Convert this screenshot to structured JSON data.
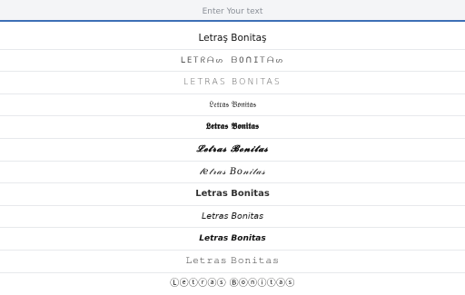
{
  "search": {
    "placeholder": "Enter Your text",
    "value": ""
  },
  "fonts": [
    {
      "text": "Letraş Bonitaş"
    },
    {
      "text": "ᒪEᎢᖇᗩᔕ ᗷOᑎIᎢᗩᔕ"
    },
    {
      "text": "LETRAS BONITAS"
    },
    {
      "text": "𝔏𝔢𝔱𝔯𝔞𝔰 𝔅𝔬𝔫𝔦𝔱𝔞𝔰"
    },
    {
      "text": "𝕷𝖊𝖙𝖗𝖆𝖘 𝕭𝖔𝖓𝖎𝖙𝖆𝖘"
    },
    {
      "text": "𝓛𝓮𝓽𝓻𝓪𝓼 𝓑𝓸𝓷𝓲𝓽𝓪𝓼"
    },
    {
      "text": "𝓁𝑒𝓉𝓇𝒶𝓈 𝐵𝑜𝓃𝒾𝓉𝒶𝓈"
    },
    {
      "text": "𝗟𝗲𝘁𝗿𝗮𝘀 𝗕𝗼𝗻𝗶𝘁𝗮𝘀"
    },
    {
      "text": "𝘓𝘦𝘵𝘳𝘢𝘴 𝘉𝘰𝘯𝘪𝘵𝘢𝘴"
    },
    {
      "text": "𝙇𝙚𝙩𝙧𝙖𝙨 𝘽𝙤𝙣𝙞𝙩𝙖𝙨"
    },
    {
      "text": "𝙻𝚎𝚝𝚛𝚊𝚜 𝙱𝚘𝚗𝚒𝚝𝚊𝚜"
    },
    {
      "text": "Ⓛⓔⓣⓡⓐⓢ Ⓑⓞⓝⓘⓣⓐⓢ"
    }
  ]
}
